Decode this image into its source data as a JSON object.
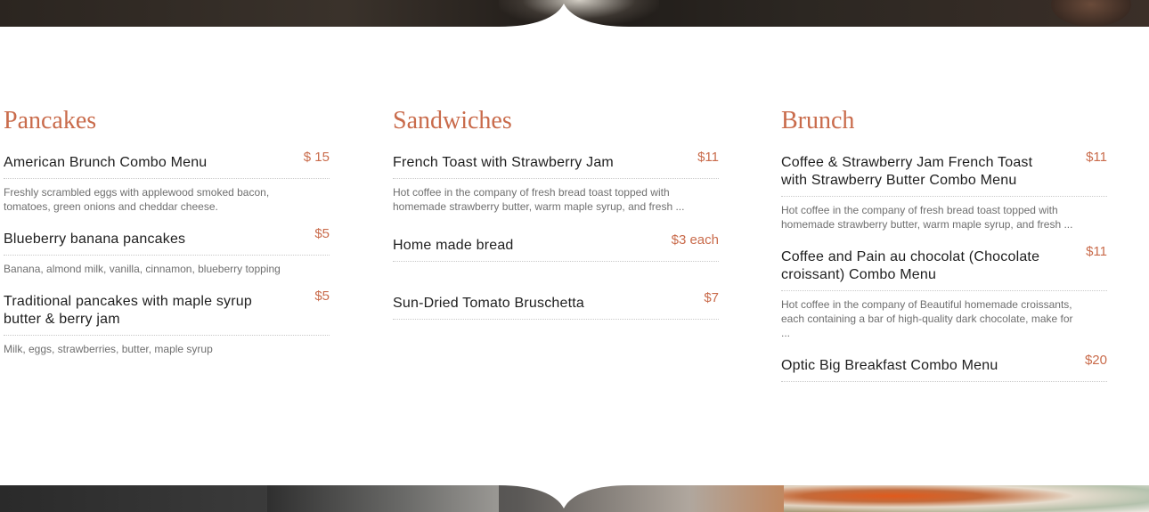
{
  "colors": {
    "accent": "#c96b4b",
    "item_name": "#1e1e1e",
    "description": "#6f6f6f",
    "divider": "#c9c9c9",
    "background": "#ffffff"
  },
  "sections": [
    {
      "title": "Pancakes",
      "items": [
        {
          "name": "American Brunch Combo Menu",
          "price": "$ 15",
          "description": "Freshly scrambled eggs with applewood smoked bacon, tomatoes, green onions and cheddar cheese."
        },
        {
          "name": "Blueberry banana pancakes",
          "price": "$5",
          "description": "Banana, almond milk, vanilla, cinnamon, blueberry topping"
        },
        {
          "name": "Traditional pancakes with maple syrup butter & berry jam",
          "price": "$5",
          "description": "Milk, eggs, strawberries, butter, maple syrup"
        }
      ]
    },
    {
      "title": "Sandwiches",
      "items": [
        {
          "name": "French Toast with Strawberry Jam",
          "price": "$11",
          "description": "Hot coffee in the company of fresh bread toast topped with homemade strawberry butter, warm maple syrup, and fresh ..."
        },
        {
          "name": "Home made bread",
          "price": "$3 each",
          "description": ""
        },
        {
          "name": "Sun-Dried Tomato Bruschetta",
          "price": "$7",
          "description": ""
        }
      ]
    },
    {
      "title": "Brunch",
      "items": [
        {
          "name": "Coffee & Strawberry Jam French Toast with Strawberry Butter Combo Menu",
          "price": "$11",
          "description": "Hot coffee in the company of fresh bread toast topped with homemade strawberry butter, warm maple syrup, and fresh ..."
        },
        {
          "name": "Coffee and Pain au chocolat (Chocolate croissant) Combo Menu",
          "price": "$11",
          "description": "Hot coffee in the company of Beautiful homemade croissants, each containing a bar of high-quality dark chocolate, make for ..."
        },
        {
          "name": "Optic Big Breakfast Combo Menu",
          "price": "$20",
          "description": ""
        }
      ]
    }
  ]
}
